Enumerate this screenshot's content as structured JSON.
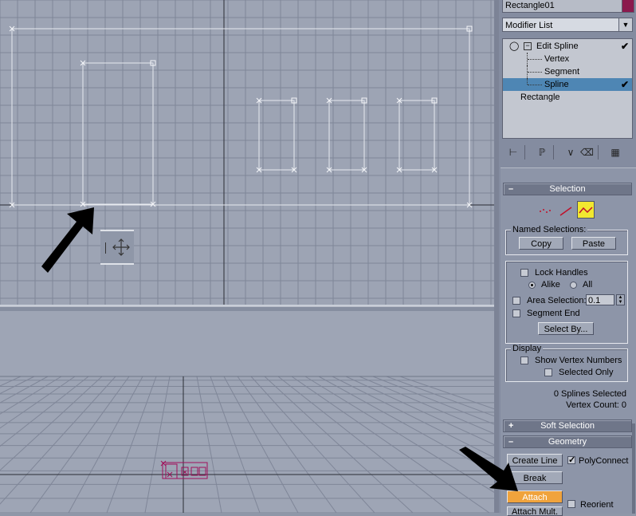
{
  "viewport_top": {
    "move_gizmo_icon": "move-icon"
  },
  "command_panel": {
    "object_name": "Rectangle01",
    "object_color": "#8b1a4d",
    "modifier_list_label": "Modifier List",
    "stack": {
      "items": [
        {
          "label": "Edit Spline"
        },
        {
          "label": "Vertex"
        },
        {
          "label": "Segment"
        },
        {
          "label": "Spline"
        },
        {
          "label": "Rectangle"
        }
      ]
    },
    "selection": {
      "title": "Selection",
      "named_selections_label": "Named Selections:",
      "copy_label": "Copy",
      "paste_label": "Paste",
      "lock_handles_label": "Lock Handles",
      "alike_label": "Alike",
      "all_label": "All",
      "area_selection_label": "Area Selection:",
      "area_selection_value": "0.1",
      "segment_end_label": "Segment End",
      "select_by_label": "Select By...",
      "display_label": "Display",
      "show_vertex_numbers_label": "Show Vertex Numbers",
      "selected_only_label": "Selected Only",
      "splines_selected": "0 Splines Selected",
      "vertex_count": "Vertex Count: 0"
    },
    "soft_selection": {
      "title": "Soft Selection"
    },
    "geometry": {
      "title": "Geometry",
      "create_line_label": "Create Line",
      "polyconnect_label": "PolyConnect",
      "break_label": "Break",
      "attach_label": "Attach",
      "reorient_label": "Reorient",
      "attach_mult_label": "Attach Mult."
    }
  }
}
